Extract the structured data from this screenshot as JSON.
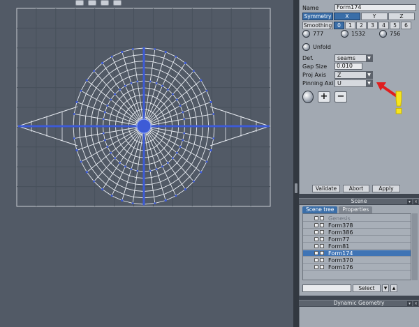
{
  "viewport": {
    "toolbar_icons": [
      "move-view-icon",
      "rotate-view-icon",
      "frame-icon",
      "object-icon"
    ]
  },
  "properties": {
    "name_label": "Name",
    "name_value": "Form174",
    "symmetry_label": "Symmetry",
    "axes": [
      "X",
      "Y",
      "Z"
    ],
    "smoothing_label": "Smoothing",
    "smoothing_levels": [
      "0",
      "1",
      "2",
      "3",
      "4",
      "5",
      "6"
    ],
    "stats": [
      "777",
      "1532",
      "756"
    ],
    "unfold_label": "Unfold",
    "def_label": "Def.",
    "def_value": "seams",
    "gap_label": "Gap Size",
    "gap_value": "0.010",
    "proj_label": "Proj Axis",
    "proj_value": "Z",
    "pin_label": "Pinning Axi",
    "pin_value": "U",
    "plus_label": "+",
    "minus_label": "−",
    "validate_label": "Validate",
    "abort_label": "Abort",
    "apply_label": "Apply",
    "annotation_mark": "!"
  },
  "scene": {
    "title": "Scene",
    "tab_tree": "Scene tree",
    "tab_props": "Properties",
    "items": [
      {
        "name": "Genesis"
      },
      {
        "name": "Form378"
      },
      {
        "name": "Form386"
      },
      {
        "name": "Form77"
      },
      {
        "name": "Form81"
      },
      {
        "name": "Form174"
      },
      {
        "name": "Form370"
      },
      {
        "name": "Form176"
      }
    ],
    "search_value": "",
    "select_label": "Select"
  },
  "dynamic": {
    "title": "Dynamic Geometry"
  },
  "colors": {
    "accent": "#3a6ea8",
    "mesh": "#e9edf3",
    "vertex": "#3d5bd6",
    "arrow": "#e01e1e",
    "exclaim": "#f7e51d"
  }
}
